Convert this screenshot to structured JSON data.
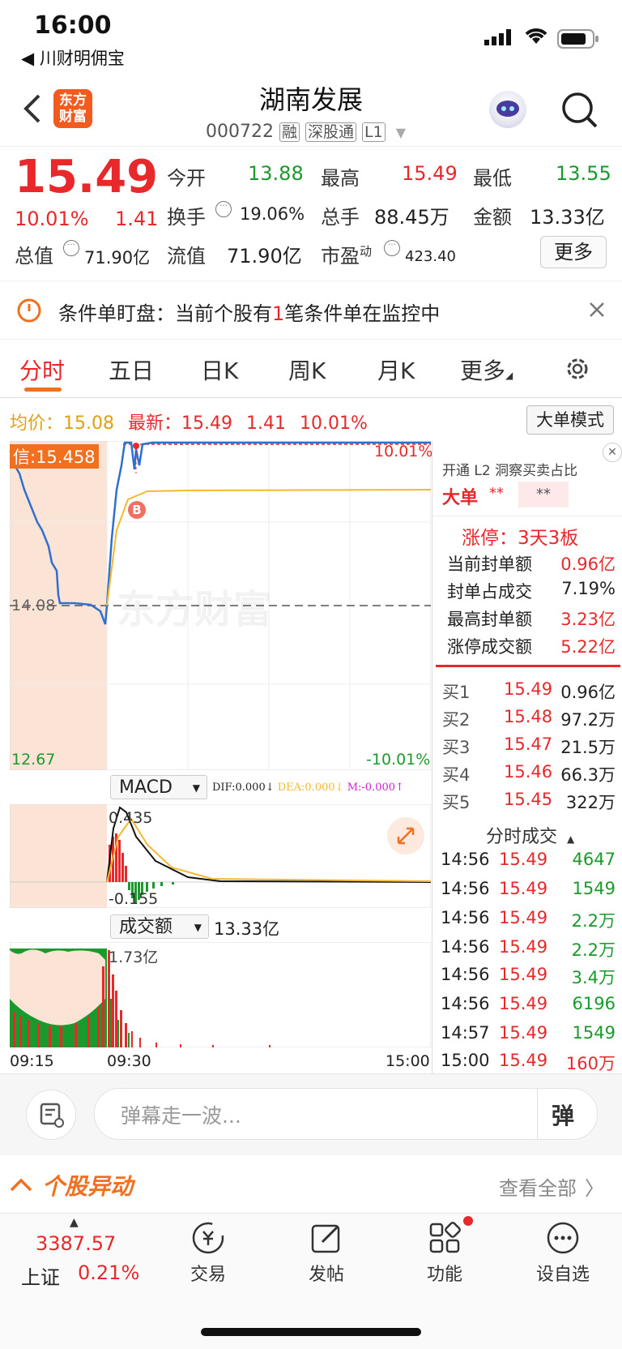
{
  "status": {
    "time": "16:00",
    "back_app": "◀ 川财明佣宝"
  },
  "header": {
    "name": "湖南发展",
    "code": "000722",
    "tags": [
      "融",
      "深股通",
      "L1"
    ],
    "logo": [
      "东方",
      "财富"
    ]
  },
  "quote": {
    "price": "15.49",
    "pct": "10.01%",
    "change": "1.41",
    "open_label": "今开",
    "open": "13.88",
    "high_label": "最高",
    "high": "15.49",
    "low_label": "最低",
    "low": "13.55",
    "turnover_label": "换手",
    "turnover": "19.06%",
    "volume_label": "总手",
    "volume": "88.45万",
    "amount_label": "金额",
    "amount": "13.33亿",
    "mcap_label": "总值",
    "mcap": "71.90亿",
    "float_label": "流值",
    "float": "71.90亿",
    "pe_label": "市盈",
    "pe_sup": "动",
    "pe": "423.40",
    "more": "更多"
  },
  "alert": {
    "prefix": "条件单盯盘：当前个股有",
    "count": "1",
    "suffix": "笔条件单在监控中"
  },
  "tabs": [
    "分时",
    "五日",
    "日K",
    "周K",
    "月K",
    "更多"
  ],
  "info": {
    "avg_label": "均价：",
    "avg": "15.08",
    "latest_label": "最新：",
    "latest": "15.49",
    "change": "1.41",
    "pct": "10.01%",
    "mode_btn": "大单模式"
  },
  "chart_labels": {
    "xin": "信:15.458",
    "top_pct": "10.01%",
    "mid": "14.08",
    "low": "12.67",
    "low_pct": "-10.01%",
    "marker": "B",
    "watermark": "东方财富"
  },
  "macd": {
    "label": "MACD",
    "dif": "DIF:0.000",
    "dea": "DEA:0.000",
    "m": "M:-0.000",
    "top": "0.435",
    "bottom": "-0.155"
  },
  "vol": {
    "label": "成交额",
    "total": "13.33亿",
    "max": "1.73亿"
  },
  "x_axis": [
    "09:15",
    "09:30",
    "15:00"
  ],
  "side": {
    "promo": "开通 L2 洞察买卖占比",
    "big_label": "大单",
    "big_a": "**",
    "big_b": "**",
    "limit": "涨停：3天3板",
    "rows": [
      {
        "label": "当前封单额",
        "value": "0.96亿"
      },
      {
        "label": "封单占成交",
        "value": "7.19%"
      },
      {
        "label": "最高封单额",
        "value": "3.23亿"
      },
      {
        "label": "涨停成交额",
        "value": "5.22亿"
      }
    ],
    "bids": [
      {
        "label": "买1",
        "price": "15.49",
        "vol": "0.96亿"
      },
      {
        "label": "买2",
        "price": "15.48",
        "vol": "97.2万"
      },
      {
        "label": "买3",
        "price": "15.47",
        "vol": "21.5万"
      },
      {
        "label": "买4",
        "price": "15.46",
        "vol": "66.3万"
      },
      {
        "label": "买5",
        "price": "15.45",
        "vol": "322万"
      }
    ],
    "trades_title": "分时成交",
    "trades": [
      {
        "time": "14:56",
        "price": "15.49",
        "vol": "4647"
      },
      {
        "time": "14:56",
        "price": "15.49",
        "vol": "1549"
      },
      {
        "time": "14:56",
        "price": "15.49",
        "vol": "2.2万"
      },
      {
        "time": "14:56",
        "price": "15.49",
        "vol": "2.2万"
      },
      {
        "time": "14:56",
        "price": "15.49",
        "vol": "3.4万"
      },
      {
        "time": "14:56",
        "price": "15.49",
        "vol": "6196"
      },
      {
        "time": "14:57",
        "price": "15.49",
        "vol": "1549"
      },
      {
        "time": "15:00",
        "price": "15.49",
        "vol": "160万"
      }
    ]
  },
  "comment": {
    "placeholder": "弹幕走一波...",
    "send": "弹"
  },
  "news": {
    "title": "个股异动",
    "view_all": "查看全部"
  },
  "bottom": {
    "index_value": "3387.57",
    "index_name": "上证",
    "index_pct": "0.21%",
    "nav": [
      "交易",
      "发帖",
      "功能",
      "设自选"
    ]
  },
  "colors": {
    "red": "#e8282b",
    "green": "#1a9a2c",
    "orange": "#f07020",
    "blue": "#2e6fd0",
    "avg_line": "#f5b82e"
  }
}
